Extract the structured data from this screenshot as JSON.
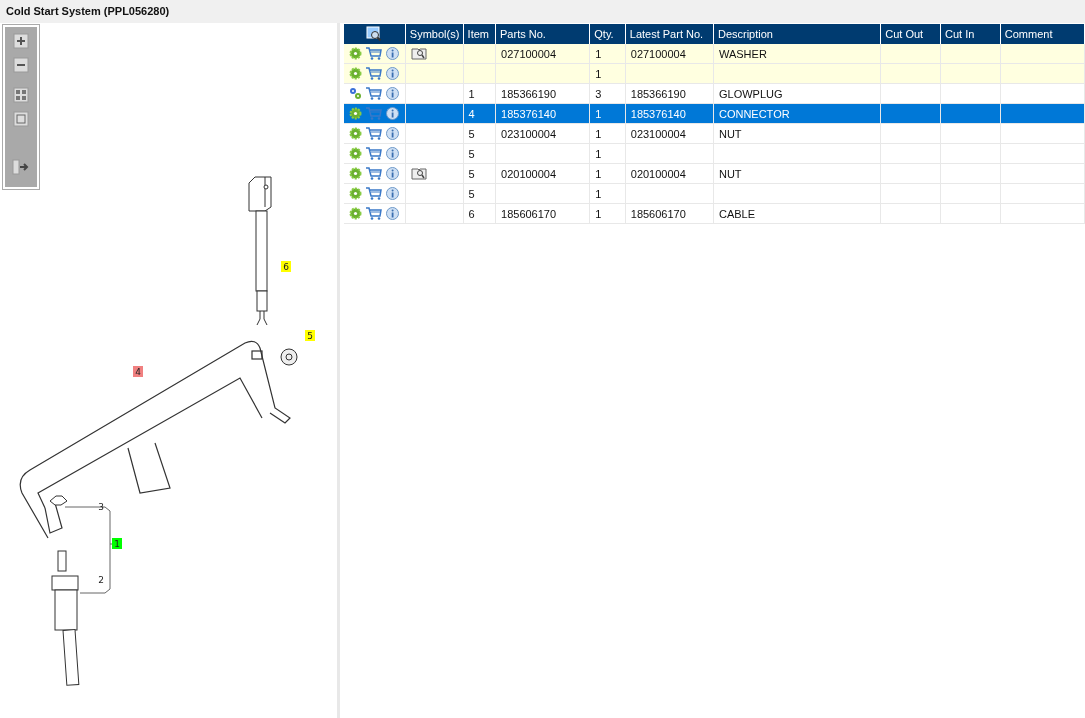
{
  "title": "Cold Start System (PPL056280)",
  "diagram": {
    "callouts": [
      {
        "label": "6",
        "color": "#ffff00"
      },
      {
        "label": "5",
        "color": "#ffff00"
      },
      {
        "label": "4",
        "color": "#f08080"
      },
      {
        "label": "1",
        "color": "#00ff00"
      },
      {
        "label": "3"
      },
      {
        "label": "2"
      }
    ]
  },
  "table": {
    "columns": [
      "Symbol(s)",
      "Item",
      "Parts No.",
      "Qty.",
      "Latest Part No.",
      "Description",
      "Cut Out",
      "Cut In",
      "Comment"
    ],
    "rows": [
      {
        "kind": "part",
        "highlighted": true,
        "selected": false,
        "has_doc": true,
        "item": "",
        "parts_no": "027100004",
        "qty": "1",
        "latest": "027100004",
        "description": "WASHER"
      },
      {
        "kind": "part",
        "highlighted": true,
        "selected": false,
        "has_doc": false,
        "item": "",
        "parts_no": "",
        "qty": "1",
        "latest": "",
        "description": ""
      },
      {
        "kind": "assembly",
        "highlighted": false,
        "selected": false,
        "has_doc": false,
        "item": "1",
        "parts_no": "185366190",
        "qty": "3",
        "latest": "185366190",
        "description": "GLOWPLUG"
      },
      {
        "kind": "part",
        "highlighted": false,
        "selected": true,
        "has_doc": false,
        "item": "4",
        "parts_no": "185376140",
        "qty": "1",
        "latest": "185376140",
        "description": "CONNECTOR"
      },
      {
        "kind": "part",
        "highlighted": false,
        "selected": false,
        "has_doc": false,
        "item": "5",
        "parts_no": "023100004",
        "qty": "1",
        "latest": "023100004",
        "description": "NUT"
      },
      {
        "kind": "part",
        "highlighted": false,
        "selected": false,
        "has_doc": false,
        "item": "5",
        "parts_no": "",
        "qty": "1",
        "latest": "",
        "description": ""
      },
      {
        "kind": "part",
        "highlighted": false,
        "selected": false,
        "has_doc": true,
        "item": "5",
        "parts_no": "020100004",
        "qty": "1",
        "latest": "020100004",
        "description": "NUT"
      },
      {
        "kind": "part",
        "highlighted": false,
        "selected": false,
        "has_doc": false,
        "item": "5",
        "parts_no": "",
        "qty": "1",
        "latest": "",
        "description": ""
      },
      {
        "kind": "part",
        "highlighted": false,
        "selected": false,
        "has_doc": false,
        "item": "6",
        "parts_no": "185606170",
        "qty": "1",
        "latest": "185606170",
        "description": "CABLE"
      }
    ]
  }
}
